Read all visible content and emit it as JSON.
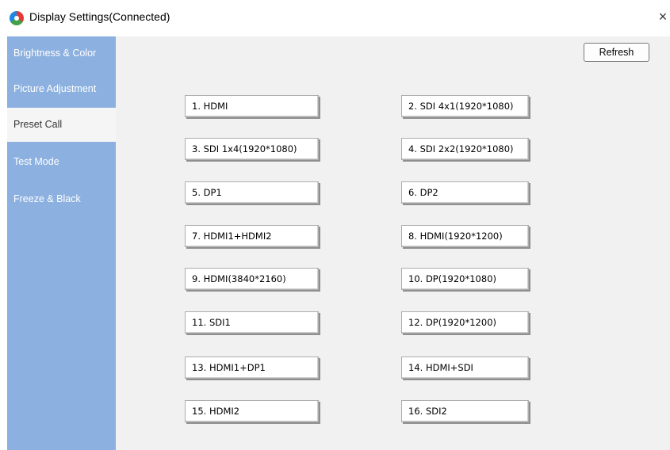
{
  "window": {
    "title": "Display Settings(Connected)",
    "close_glyph": "×"
  },
  "sidebar": {
    "items": [
      {
        "label": "Brightness & Color",
        "active": false
      },
      {
        "label": "Picture Adjustment",
        "active": false
      },
      {
        "label": "Preset Call",
        "active": true
      },
      {
        "label": "Test Mode",
        "active": false
      },
      {
        "label": "Freeze & Black",
        "active": false
      }
    ]
  },
  "toolbar": {
    "refresh_label": "Refresh"
  },
  "presets": [
    "1. HDMI",
    "2. SDI 4x1(1920*1080)",
    "3. SDI 1x4(1920*1080)",
    "4. SDI 2x2(1920*1080)",
    "5. DP1",
    "6. DP2",
    "7. HDMI1+HDMI2",
    "8. HDMI(1920*1200)",
    "9. HDMI(3840*2160)",
    "10. DP(1920*1080)",
    "11. SDI1",
    "12. DP(1920*1200)",
    "13. HDMI1+DP1",
    "14. HDMI+SDI",
    "15. HDMI2",
    "16. SDI2"
  ],
  "colors": {
    "sidebar_bg": "#8cb0df",
    "sidebar_active_bg": "#f5f5f5",
    "content_bg": "#f1f1f1"
  }
}
